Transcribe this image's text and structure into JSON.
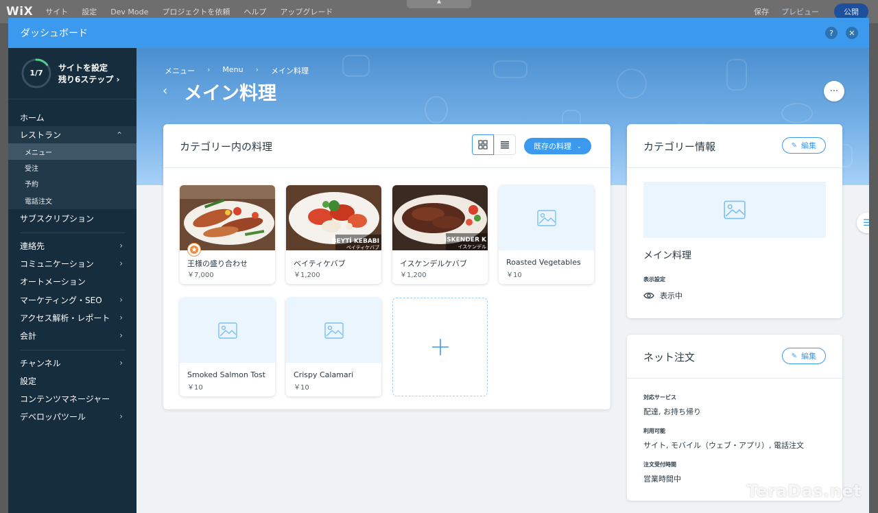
{
  "topbar": {
    "logo": "WiX",
    "menu": [
      "サイト",
      "設定",
      "Dev Mode",
      "プロジェクトを依頼",
      "ヘルプ",
      "アップグレード"
    ],
    "save": "保存",
    "preview": "プレビュー",
    "publish": "公開"
  },
  "dashboard": {
    "title": "ダッシュボード",
    "help": "?",
    "close": "✕"
  },
  "setup": {
    "progress": "1/7",
    "progress_fraction": 0.142857,
    "title": "サイトを設定",
    "subtitle": "残り6ステップ ›"
  },
  "sidebar": {
    "items": [
      {
        "label": "ホーム",
        "chevron": ""
      },
      {
        "label": "レストラン",
        "chevron": "⌃"
      },
      {
        "label": "サブスクリプション",
        "chevron": ""
      },
      {
        "label": "連絡先",
        "chevron": "›"
      },
      {
        "label": "コミュニケーション",
        "chevron": "›"
      },
      {
        "label": "オートメーション",
        "chevron": ""
      },
      {
        "label": "マーケティング・SEO",
        "chevron": "›"
      },
      {
        "label": "アクセス解析・レポート",
        "chevron": "›"
      },
      {
        "label": "会計",
        "chevron": "›"
      },
      {
        "label": "チャンネル",
        "chevron": "›"
      },
      {
        "label": "設定",
        "chevron": ""
      },
      {
        "label": "コンテンツマネージャー",
        "chevron": ""
      },
      {
        "label": "デベロッパツール",
        "chevron": "›"
      }
    ],
    "restaurant_sub": [
      "メニュー",
      "受注",
      "予約",
      "電話注文"
    ]
  },
  "breadcrumb": {
    "items": [
      "メニュー",
      "Menu",
      "メイン料理"
    ],
    "sep": "›"
  },
  "page": {
    "back": "‹",
    "title": "メイン料理",
    "more": "···",
    "side_handle": "☰"
  },
  "dishes_card": {
    "title": "カテゴリー内の料理",
    "existing_button": "既存の料理",
    "existing_dd": "⌄",
    "dishes": [
      {
        "name": "王様の盛り合わせ",
        "price": "￥7,000",
        "photo": "kebab-platter",
        "featured": true
      },
      {
        "name": "ベイティケバブ",
        "price": "￥1,200",
        "photo": "beyti-kebab",
        "overlay_text": "BEYTİ KEBABI",
        "overlay_sub": "ベイティケバブ",
        "featured": false
      },
      {
        "name": "イスケンデルケバブ",
        "price": "￥1,200",
        "photo": "iskender-kebab",
        "overlay_text": "İSKENDER K",
        "overlay_sub": "イスケンデル",
        "featured": false
      },
      {
        "name": "Roasted Vegetables",
        "price": "￥10",
        "photo": "",
        "featured": false
      },
      {
        "name": "Smoked Salmon Tost",
        "price": "￥10",
        "photo": "",
        "featured": false
      },
      {
        "name": "Crispy Calamari",
        "price": "￥10",
        "photo": "",
        "featured": false
      }
    ],
    "add": "+"
  },
  "category_card": {
    "title": "カテゴリー情報",
    "edit": "編集",
    "name": "メイン料理",
    "display_label": "表示設定",
    "display_value": "表示中"
  },
  "online_card": {
    "title": "ネット注文",
    "edit": "編集",
    "fields": [
      {
        "label": "対応サービス",
        "value": "配達, お持ち帰り"
      },
      {
        "label": "利用可能",
        "value": "サイト, モバイル（ウェブ・アプリ）, 電話注文"
      },
      {
        "label": "注文受付時間",
        "value": "営業時間中"
      }
    ]
  },
  "watermark": "TeraDas.net",
  "colors": {
    "accent": "#3b9aed",
    "sidebar": "#162d3d",
    "progress": "#4fd18b"
  }
}
